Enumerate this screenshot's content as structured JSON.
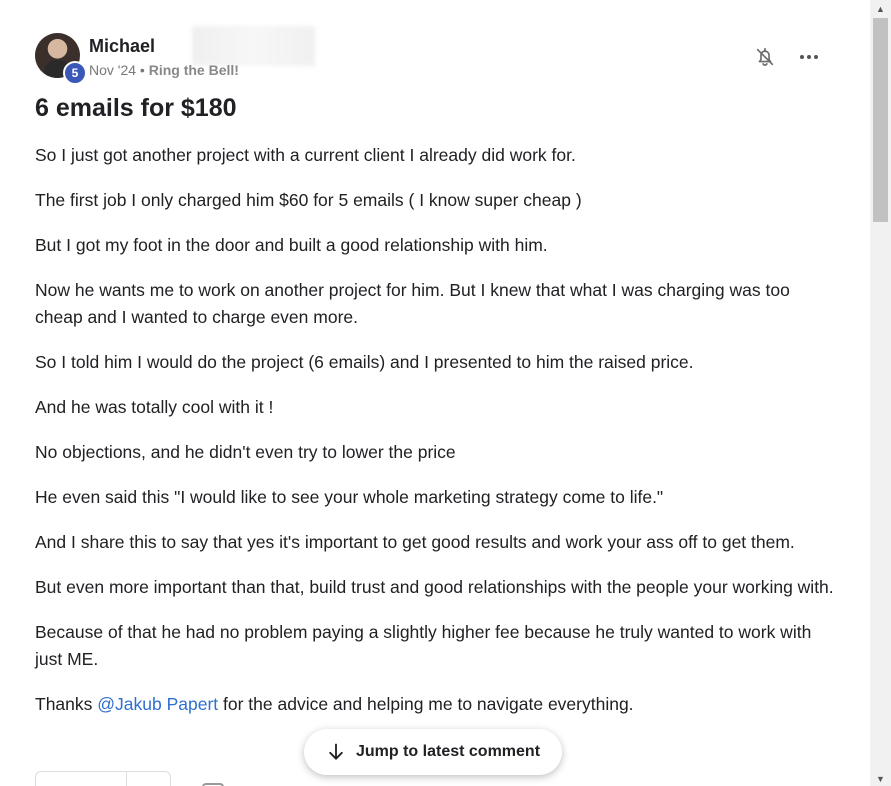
{
  "post": {
    "author": "Michael",
    "level": "5",
    "date": "Nov '24",
    "separator": "•",
    "category": "Ring the Bell!",
    "title": "6 emails for $180",
    "paragraphs": [
      "So I just got another project with a current client I already did work for.",
      "The first job I only charged him $60 for 5 emails ( I know super cheap )",
      "But I got my foot in the door and built a good relationship with him.",
      "Now he wants me to work on another project for him. But I knew that what I was charging was too cheap and I wanted to charge even more.",
      "So I told him I would do the project (6 emails) and I presented to him the raised price.",
      "And he was totally cool with it !",
      "No objections, and he didn't even try to lower the price",
      "He even said this \"I would like to see your whole marketing strategy come to life.\"",
      "And I share this to say that yes it's important to get good results and work your ass off to get them.",
      "But even more important than that, build trust and good relationships with the people your working with.",
      "Because of that he had no problem paying a slightly higher fee because he truly wanted to work with just ME."
    ],
    "thanks_prefix": "Thanks ",
    "mention": "@Jakub Papert",
    "thanks_suffix": " for the advice and helping me to navigate everything."
  },
  "actions": {
    "jump_label": "Jump to latest comment"
  },
  "icons": {
    "bell": "bell-off-icon",
    "more": "more-horizontal-icon",
    "jump": "arrow-down-icon"
  },
  "colors": {
    "level_badge": "#3b57b8",
    "mention": "#2f6fd1"
  }
}
